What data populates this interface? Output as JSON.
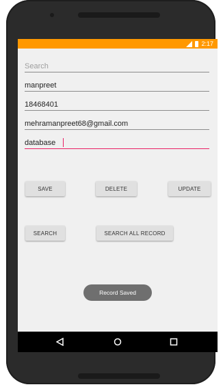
{
  "status_bar": {
    "time": "2:17",
    "color": "#ff9800"
  },
  "form": {
    "search": {
      "placeholder": "Search",
      "value": ""
    },
    "name": {
      "value": "manpreet"
    },
    "phone": {
      "value": "18468401"
    },
    "email": {
      "value": "mehramanpreet68@gmail.com"
    },
    "subject": {
      "value": "database"
    }
  },
  "buttons": {
    "save_label": "SAVE",
    "delete_label": "DELETE",
    "update_label": "UPDATE",
    "search_label": "SEARCH",
    "search_all_label": "SEARCH ALL RECORD"
  },
  "toast": {
    "message": "Record Saved"
  },
  "nav": {
    "icons": [
      "back-icon",
      "home-icon",
      "recents-icon"
    ]
  }
}
